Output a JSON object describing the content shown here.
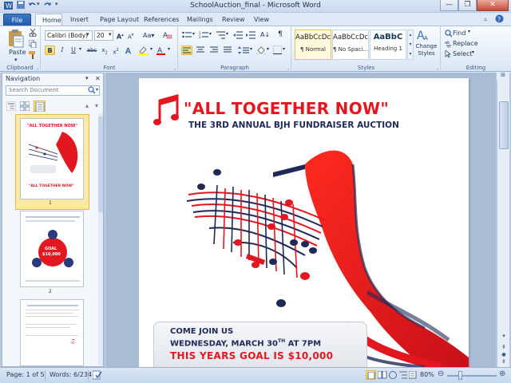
{
  "window": {
    "title": "SchoolAuction_final - Microsoft Word"
  },
  "qat": {
    "save_icon": "save-icon",
    "undo_icon": "undo-icon",
    "redo_icon": "redo-icon"
  },
  "tabs": [
    {
      "label": "File"
    },
    {
      "label": "Home"
    },
    {
      "label": "Insert"
    },
    {
      "label": "Page Layout"
    },
    {
      "label": "References"
    },
    {
      "label": "Mailings"
    },
    {
      "label": "Review"
    },
    {
      "label": "View"
    }
  ],
  "ribbon": {
    "clipboard": {
      "paste": "Paste",
      "label": "Clipboard"
    },
    "font": {
      "name": "Calibri (Body)",
      "size": "20",
      "label": "Font"
    },
    "paragraph": {
      "label": "Paragraph"
    },
    "styles": {
      "label": "Styles",
      "items": [
        {
          "preview": "AaBbCcDc",
          "name": "¶ Normal"
        },
        {
          "preview": "AaBbCcDc",
          "name": "¶ No Spaci..."
        },
        {
          "preview": "AaBbC",
          "name": "Heading 1"
        }
      ],
      "change_styles": "Change Styles"
    },
    "editing": {
      "label": "Editing",
      "find": "Find",
      "replace": "Replace",
      "select": "Select"
    }
  },
  "navigation": {
    "title": "Navigation",
    "search_placeholder": "Search Document",
    "pages": [
      "1",
      "2"
    ]
  },
  "thumb": {
    "p1_title": "\"ALL TOGETHER NOW\"",
    "p1_bottom": "\"ALL TOGETHER NOW\"",
    "p2_goal": "GOAL",
    "p2_amount": "$10,000"
  },
  "document": {
    "title": "\"ALL TOGETHER NOW\"",
    "subtitle": "THE 3RD ANNUAL BJH FUNDRAISER AUCTION",
    "join": "COME JOIN US",
    "date_prefix": "WEDNESDAY, MARCH 30",
    "date_sup": "TH",
    "date_suffix": " AT 7PM",
    "goal": "THIS YEARS GOAL IS $10,000"
  },
  "status": {
    "page": "Page: 1 of 5",
    "words": "Words: 6/234",
    "zoom": "80%"
  },
  "colors": {
    "accent": "#2b579a",
    "red": "#e3171f",
    "navy": "#1f2957"
  }
}
